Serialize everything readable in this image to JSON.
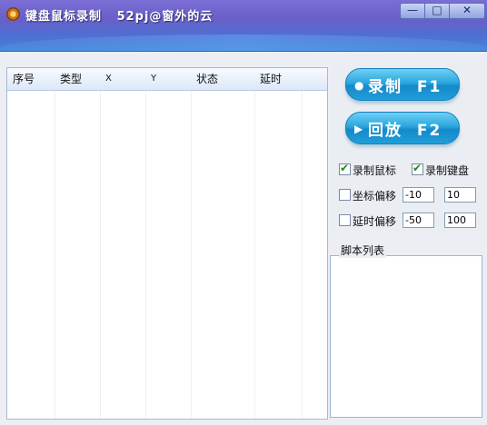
{
  "window": {
    "title": "键盘鼠标录制   52pj@窗外的云",
    "controls": {
      "minimize": "—",
      "maximize": "□",
      "close": "✕"
    }
  },
  "list": {
    "columns": [
      "序号",
      "类型",
      "X",
      "Y",
      "状态",
      "延时"
    ],
    "rows": []
  },
  "buttons": {
    "record": {
      "label": "录制  F1",
      "icon": "record-dot-icon"
    },
    "replay": {
      "label": "回放  F2",
      "icon": "play-triangle-icon"
    }
  },
  "options": {
    "record_mouse": {
      "label": "录制鼠标",
      "checked": true
    },
    "record_keyboard": {
      "label": "录制键盘",
      "checked": true
    },
    "coord_offset": {
      "label": "坐标偏移",
      "checked": false,
      "min": "-10",
      "max": "10"
    },
    "delay_offset": {
      "label": "延时偏移",
      "checked": false,
      "min": "-50",
      "max": "100"
    }
  },
  "script_list": {
    "title": "脚本列表",
    "items": []
  },
  "colors": {
    "title_bar": "#5f6ccf",
    "button": "#2aa6df",
    "border": "#a9b8cf"
  }
}
